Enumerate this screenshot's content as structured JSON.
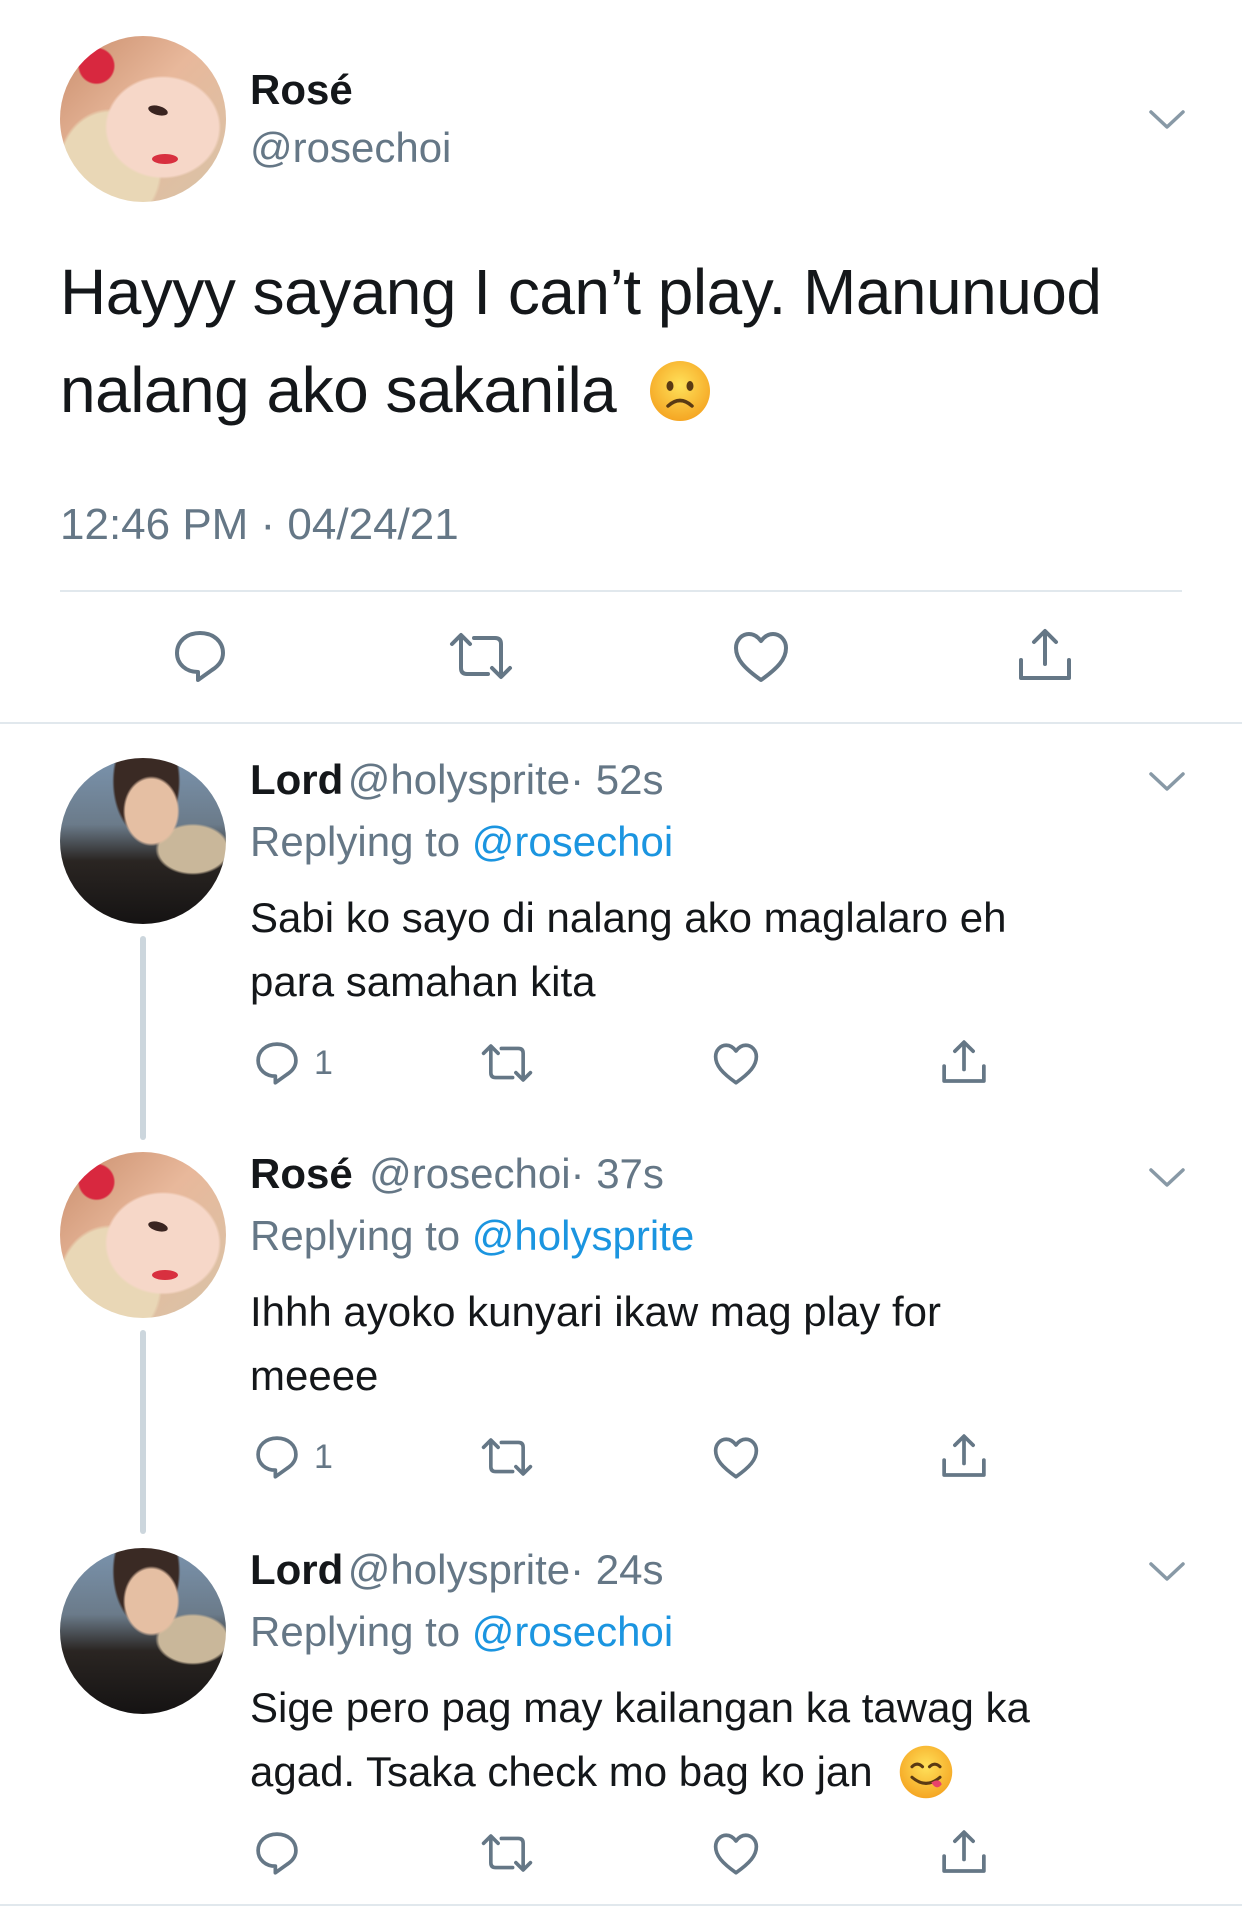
{
  "main_tweet": {
    "author_name": "Rosé",
    "author_handle": "@rosechoi",
    "text": "Hayyy sayang I can’t play. Manunuod",
    "text_line2": "nalang ako sakanila",
    "emoji": "frowning-face",
    "timestamp": "12:46 PM · 04/24/21"
  },
  "replies": [
    {
      "author_name": "Lord",
      "author_handle": "@holysprite",
      "time": "· 52s",
      "replying_label": "Replying to",
      "replying_handle": "@rosechoi",
      "text_line1": "Sabi ko sayo di nalang ako maglalaro eh",
      "text_line2": "para samahan kita",
      "reply_count": "1"
    },
    {
      "author_name": "Rosé",
      "author_handle": "@rosechoi",
      "time": "· 37s",
      "replying_label": "Replying to",
      "replying_handle": "@holysprite",
      "text_line1": "Ihhh ayoko kunyari ikaw mag play for",
      "text_line2": "meeee",
      "reply_count": "1"
    },
    {
      "author_name": "Lord",
      "author_handle": "@holysprite",
      "time": "· 24s",
      "replying_label": "Replying to",
      "replying_handle": "@rosechoi",
      "text_line1": "Sige pero pag may kailangan ka tawag ka",
      "text_line2": "agad. Tsaka check mo bag ko jan",
      "emoji": "face-savoring-food",
      "reply_count": ""
    }
  ],
  "colors": {
    "text": "#14171a",
    "secondary": "#657786",
    "link": "#1b95e0",
    "divider": "#e1e8ed",
    "thread_line": "#ccd6dd"
  }
}
